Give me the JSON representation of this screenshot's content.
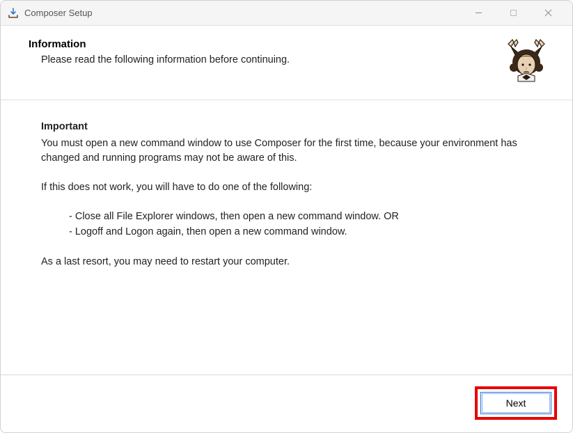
{
  "titlebar": {
    "title": "Composer Setup"
  },
  "header": {
    "title": "Information",
    "subtitle": "Please read the following information before continuing."
  },
  "content": {
    "important_label": "Important",
    "para1": "You must open a new command window to use Composer for the first time, because your environment has changed and running programs may not be aware of this.",
    "para2": "If this does not work, you will have to do one of the following:",
    "bullet1": "- Close all File Explorer windows, then open a new command window. OR",
    "bullet2": "- Logoff and Logon again, then open a new command window.",
    "para3": "As a last resort, you may need to restart your computer."
  },
  "footer": {
    "next_label": "Next"
  }
}
